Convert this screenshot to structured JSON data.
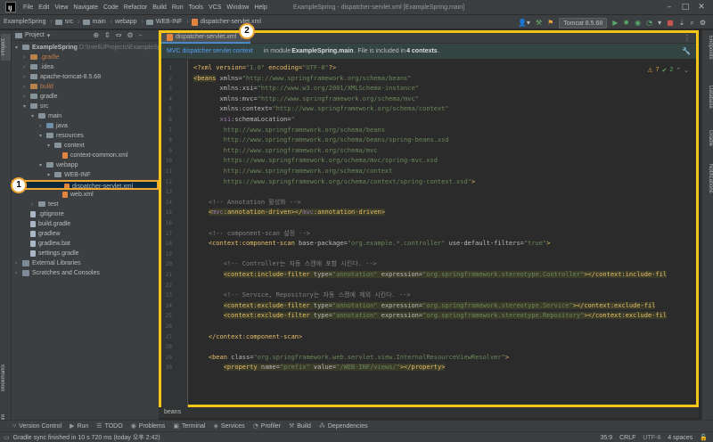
{
  "menubar": {
    "logo": "IJ",
    "items": [
      "File",
      "Edit",
      "View",
      "Navigate",
      "Code",
      "Refactor",
      "Build",
      "Run",
      "Tools",
      "VCS",
      "Window",
      "Help"
    ],
    "title": "ExampleSpring - dispatcher-servlet.xml [ExampleSpring.main]"
  },
  "navbar": {
    "crumbs": [
      "ExampleSpring",
      "src",
      "main",
      "webapp",
      "WEB-INF",
      "dispatcher-servlet.xml"
    ],
    "run_config": "Tomcat 8.5.68"
  },
  "left_stripe": {
    "project": "Project",
    "bookmarks": "Bookmarks",
    "structure": "Structure"
  },
  "right_stripe": {
    "endpoints": "Endpoints",
    "database": "Database",
    "gradle": "Gradle",
    "notifications": "Notifications"
  },
  "project": {
    "header": "Project",
    "tree": [
      {
        "label": "ExampleSpring",
        "path": "D:\\IntelliJProjects\\ExampleSpring",
        "level": 0,
        "arrow": "▾",
        "icon": "folder"
      },
      {
        "label": ".gradle",
        "level": 1,
        "arrow": "›",
        "icon": "orange",
        "dim": true
      },
      {
        "label": ".idea",
        "level": 1,
        "arrow": "›",
        "icon": "folder"
      },
      {
        "label": "apache-tomcat-8.5.68",
        "level": 1,
        "arrow": "›",
        "icon": "folder"
      },
      {
        "label": "build",
        "level": 1,
        "arrow": "›",
        "icon": "orange",
        "dim": true
      },
      {
        "label": "gradle",
        "level": 1,
        "arrow": "›",
        "icon": "folder"
      },
      {
        "label": "src",
        "level": 1,
        "arrow": "▾",
        "icon": "folder"
      },
      {
        "label": "main",
        "level": 2,
        "arrow": "▾",
        "icon": "folder"
      },
      {
        "label": "java",
        "level": 3,
        "arrow": "›",
        "icon": "blue"
      },
      {
        "label": "resources",
        "level": 3,
        "arrow": "▾",
        "icon": "folder"
      },
      {
        "label": "context",
        "level": 4,
        "arrow": "▾",
        "icon": "folder"
      },
      {
        "label": "context-common.xml",
        "level": 5,
        "arrow": "",
        "icon": "xml"
      },
      {
        "label": "webapp",
        "level": 3,
        "arrow": "▾",
        "icon": "folder"
      },
      {
        "label": "WEB-INF",
        "level": 4,
        "arrow": "▾",
        "icon": "folder"
      },
      {
        "label": "dispatcher-servlet.xml",
        "level": 5,
        "arrow": "",
        "icon": "xml",
        "selected": true
      },
      {
        "label": "web.xml",
        "level": 5,
        "arrow": "",
        "icon": "xml"
      },
      {
        "label": "test",
        "level": 2,
        "arrow": "›",
        "icon": "folder"
      },
      {
        "label": ".gitignore",
        "level": 1,
        "arrow": "",
        "icon": "file"
      },
      {
        "label": "build.gradle",
        "level": 1,
        "arrow": "",
        "icon": "file"
      },
      {
        "label": "gradlew",
        "level": 1,
        "arrow": "",
        "icon": "file"
      },
      {
        "label": "gradlew.bat",
        "level": 1,
        "arrow": "",
        "icon": "file"
      },
      {
        "label": "settings.gradle",
        "level": 1,
        "arrow": "",
        "icon": "file"
      },
      {
        "label": "External Libraries",
        "level": 0,
        "arrow": "›",
        "icon": "lib"
      },
      {
        "label": "Scratches and Consoles",
        "level": 0,
        "arrow": "›",
        "icon": "lib"
      }
    ]
  },
  "editor": {
    "tab": "dispatcher-servlet.xml",
    "banner_link": "MVC dispatcher servlet context",
    "banner_text_pre": "in module ",
    "banner_module": "ExampleSpring.main",
    "banner_text_post": ". File is included in ",
    "banner_contexts": "4 contexts",
    "banner_end": ".",
    "inspections": {
      "warnings": "7",
      "ok": "2"
    },
    "breadcrumb": "beans",
    "lines": [
      {
        "n": "1",
        "html": "<span class=\"c-pi\">&lt;?xml version=</span><span class=\"c-str\">\"1.0\"</span><span class=\"c-pi\"> encoding=</span><span class=\"c-str\">\"UTF-8\"</span><span class=\"c-pi\">?&gt;</span>"
      },
      {
        "n": "2",
        "html": "<span class=\"c-tag hl\">&lt;beans</span> <span class=\"c-attr\">xmlns=</span><span class=\"c-str\">\"http://www.springframework.org/schema/beans\"</span>"
      },
      {
        "n": "3",
        "html": "       <span class=\"c-attr\">xmlns:xsi=</span><span class=\"c-str\">\"http://www.w3.org/2001/XMLSchema-instance\"</span>"
      },
      {
        "n": "4",
        "html": "       <span class=\"c-attr\">xmlns:mvc=</span><span class=\"c-str\">\"http://www.springframework.org/schema/mvc\"</span>"
      },
      {
        "n": "5",
        "html": "       <span class=\"c-attr\">xmlns:context=</span><span class=\"c-str\">\"http://www.springframework.org/schema/context\"</span>"
      },
      {
        "n": "6",
        "html": "       <span class=\"c-ns\">xsi</span><span class=\"c-attr\">:schemaLocation=</span><span class=\"c-str\">\"</span>"
      },
      {
        "n": "7",
        "html": "        <span class=\"c-str\">http://www.springframework.org/schema/beans</span>"
      },
      {
        "n": "8",
        "html": "        <span class=\"c-str\">http://www.springframework.org/schema/beans/spring-beans.xsd</span>"
      },
      {
        "n": "9",
        "html": "        <span class=\"c-str\">http://www.springframework.org/schema/mvc</span>"
      },
      {
        "n": "10",
        "html": "        <span class=\"c-str\">https://www.springframework.org/schema/mvc/spring-mvc.xsd</span>"
      },
      {
        "n": "11",
        "html": "        <span class=\"c-str\">http://www.springframework.org/schema/context</span>"
      },
      {
        "n": "12",
        "html": "        <span class=\"c-str\">https://www.springframework.org/schema/context/spring-context.xsd\"</span><span class=\"c-tag\">&gt;</span>"
      },
      {
        "n": "13",
        "html": ""
      },
      {
        "n": "14",
        "html": "    <span class=\"c-com\">&lt;!-- Annotation 활성화 --&gt;</span>"
      },
      {
        "n": "15",
        "html": "    <span class=\"hl\"><span class=\"c-tag\">&lt;</span><span class=\"c-ns\">mvc</span><span class=\"c-tag\">:annotation-driven&gt;&lt;/</span><span class=\"c-ns\">mvc</span><span class=\"c-tag\">:annotation-driven&gt;</span></span>"
      },
      {
        "n": "16",
        "html": ""
      },
      {
        "n": "17",
        "html": "    <span class=\"c-com\">&lt;!-- component-scan 설정 --&gt;</span>"
      },
      {
        "n": "18",
        "html": "    <span class=\"c-tag\">&lt;context:component-scan</span> <span class=\"c-attr\">base-package=</span><span class=\"c-str\">\"org.example.*.controller\"</span> <span class=\"c-attr\">use-default-filters=</span><span class=\"c-str\">\"true\"</span><span class=\"c-tag\">&gt;</span>"
      },
      {
        "n": "19",
        "html": ""
      },
      {
        "n": "20",
        "html": "        <span class=\"c-com\">&lt;!-- Controller는 자동 스캔에 포함 시킨다. --&gt;</span>"
      },
      {
        "n": "21",
        "html": "        <span class=\"hl\"><span class=\"c-tag\">&lt;context:include-filter</span> <span class=\"c-attr\">type=</span><span class=\"c-str\">\"annotation\"</span> <span class=\"c-attr\">expression=</span><span class=\"c-str\">\"org.springframework.stereotype.Controller\"</span><span class=\"c-tag\">&gt;&lt;/context:include-fil</span></span>"
      },
      {
        "n": "22",
        "html": ""
      },
      {
        "n": "23",
        "html": "        <span class=\"c-com\">&lt;!-- Service, Repository는 자동 스캔에 제외 시킨다. --&gt;</span>"
      },
      {
        "n": "24",
        "html": "        <span class=\"hl\"><span class=\"c-tag\">&lt;context:exclude-filter</span> <span class=\"c-attr\">type=</span><span class=\"c-str\">\"annotation\"</span> <span class=\"c-attr\">expression=</span><span class=\"c-str\">\"org.springframework.stereotype.Service\"</span><span class=\"c-tag\">&gt;&lt;/context:exclude-fil</span></span>"
      },
      {
        "n": "25",
        "html": "        <span class=\"hl\"><span class=\"c-tag\">&lt;context:exclude-filter</span> <span class=\"c-attr\">type=</span><span class=\"c-str\">\"annotation\"</span> <span class=\"c-attr\">expression=</span><span class=\"c-str\">\"org.springframework.stereotype.Repository\"</span><span class=\"c-tag\">&gt;&lt;/context:exclude-fil</span></span>"
      },
      {
        "n": "26",
        "html": ""
      },
      {
        "n": "27",
        "html": "    <span class=\"c-tag\">&lt;/context:component-scan&gt;</span>"
      },
      {
        "n": "28",
        "html": ""
      },
      {
        "n": "29",
        "html": "    <span class=\"c-tag\">&lt;bean</span> <span class=\"c-attr\">class=</span><span class=\"c-str\">\"org.springframework.web.servlet.view.InternalResourceViewResolver\"</span><span class=\"c-tag\">&gt;</span>"
      },
      {
        "n": "30",
        "html": "        <span class=\"hl\"><span class=\"c-tag\">&lt;property</span> <span class=\"c-attr\">name=</span><span class=\"c-str\">\"prefix\"</span> <span class=\"c-attr\">value=</span><span class=\"c-str\">\"/WEB-INF/views/\"</span><span class=\"c-tag\">&gt;&lt;/property&gt;</span></span>"
      }
    ]
  },
  "bottom_tools": [
    "Version Control",
    "Run",
    "TODO",
    "Problems",
    "Terminal",
    "Services",
    "Profiler",
    "Build",
    "Dependencies"
  ],
  "status": {
    "message": "Gradle sync finished in 10 s 720 ms (today 오후 2:42)",
    "position": "35:9",
    "line_sep": "CRLF",
    "encoding": "UTF-8",
    "indent": "4 spaces"
  },
  "markers": {
    "one": "1",
    "two": "2"
  },
  "colors": {
    "accent": "#f5c518",
    "selection": "#0d293e",
    "link": "#589df6"
  }
}
